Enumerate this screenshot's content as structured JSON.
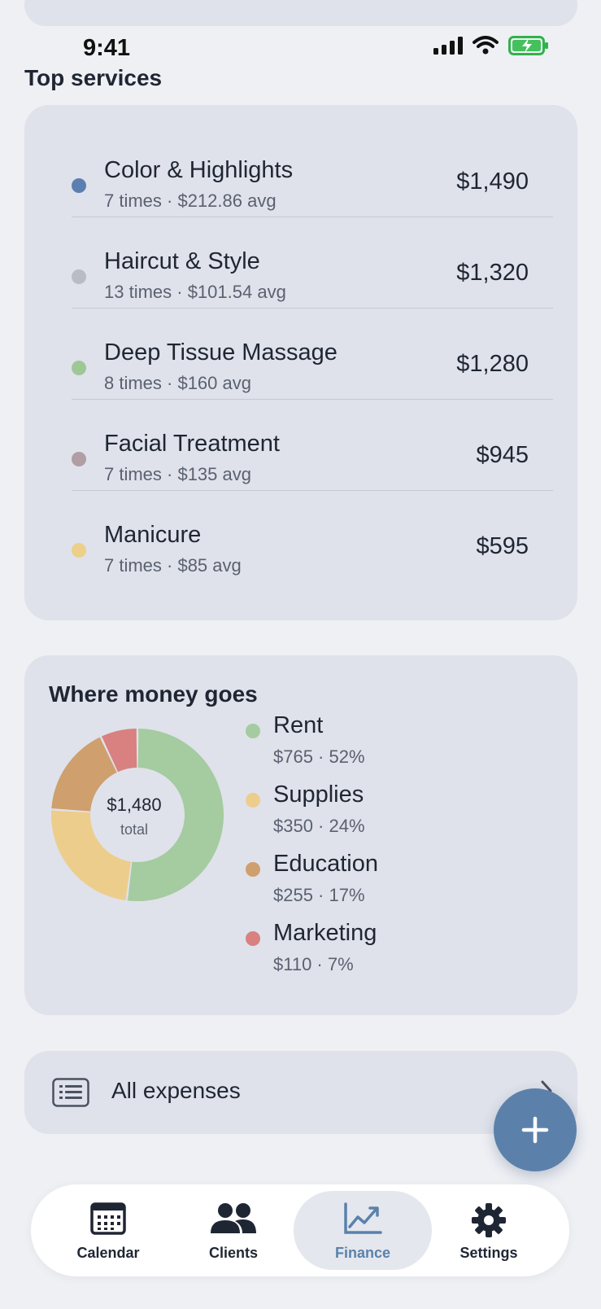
{
  "status_bar": {
    "time": "9:41"
  },
  "top_services": {
    "title": "Top services",
    "items": [
      {
        "name": "Color & Highlights",
        "meta": "7 times · $212.86 avg",
        "amount": "$1,490",
        "color": "#5b7fb0"
      },
      {
        "name": "Haircut & Style",
        "meta": "13 times · $101.54 avg",
        "amount": "$1,320",
        "color": "#b9bcc4"
      },
      {
        "name": "Deep Tissue Massage",
        "meta": "8 times · $160 avg",
        "amount": "$1,280",
        "color": "#9ec796"
      },
      {
        "name": "Facial Treatment",
        "meta": "7 times · $135 avg",
        "amount": "$945",
        "color": "#b09ea4"
      },
      {
        "name": "Manicure",
        "meta": "7 times · $85 avg",
        "amount": "$595",
        "color": "#ecd08a"
      }
    ]
  },
  "money": {
    "title": "Where money goes",
    "total_value": "$1,480",
    "total_label": "total",
    "items": [
      {
        "name": "Rent",
        "detail": "$765 · 52%",
        "percent": 52,
        "color": "#a5cba0"
      },
      {
        "name": "Supplies",
        "detail": "$350 · 24%",
        "percent": 24,
        "color": "#edcd8c"
      },
      {
        "name": "Education",
        "detail": "$255 · 17%",
        "percent": 17,
        "color": "#cf9f6e"
      },
      {
        "name": "Marketing",
        "detail": "$110 · 7%",
        "percent": 7,
        "color": "#d98080"
      }
    ]
  },
  "expenses": {
    "label": "All expenses"
  },
  "tabs": [
    {
      "label": "Calendar",
      "icon": "calendar-icon",
      "active": false
    },
    {
      "label": "Clients",
      "icon": "people-icon",
      "active": false
    },
    {
      "label": "Finance",
      "icon": "chart-icon",
      "active": true
    },
    {
      "label": "Settings",
      "icon": "gear-icon",
      "active": false
    }
  ],
  "colors": {
    "accent": "#5b81ab",
    "card": "#dfe2ea",
    "background": "#eef0f4"
  }
}
